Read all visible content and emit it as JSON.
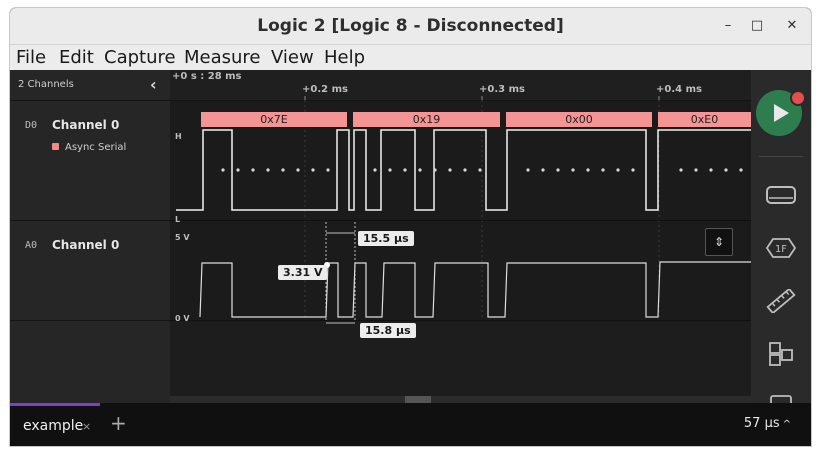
{
  "window": {
    "title": "Logic 2 [Logic 8 - Disconnected]",
    "controls": {
      "minimize": "–",
      "maximize": "□",
      "close": "✕"
    }
  },
  "menu": [
    "File",
    "Edit",
    "Capture",
    "Measure",
    "View",
    "Help"
  ],
  "sidebar": {
    "header": "2 Channels",
    "collapse_glyph": "‹",
    "channels": [
      {
        "id": "D0",
        "name": "Channel 0",
        "analyzer": "Async Serial",
        "analyzer_color": "#f28a8a"
      },
      {
        "id": "A0",
        "name": "Channel 0"
      }
    ]
  },
  "timeline": {
    "start": "+0 s : 28 ms",
    "ticks": [
      "+0.2 ms",
      "+0.3 ms",
      "+0.4 ms"
    ]
  },
  "digital": {
    "high_label": "H",
    "low_label": "L",
    "frames": [
      "0x7E",
      "0x19",
      "0x00",
      "0xE0"
    ]
  },
  "analog": {
    "top_label": "5 V",
    "bottom_label": "0 V",
    "voltage_readout": "3.31 V",
    "width_top": "15.5 µs",
    "width_bottom": "15.8 µs"
  },
  "tabs": [
    {
      "label": "example",
      "close": "×"
    }
  ],
  "add_tab": "+",
  "zoom": {
    "value": "57 µs",
    "caret": "^"
  },
  "colors": {
    "accent": "#7b3fd1",
    "play": "#2e7d4f",
    "record": "#e05050",
    "analyzer": "#f49494"
  },
  "right_icons": [
    "play-icon",
    "device-icon",
    "analyzer-icon",
    "measure-icon",
    "extensions-icon",
    "comment-icon"
  ]
}
